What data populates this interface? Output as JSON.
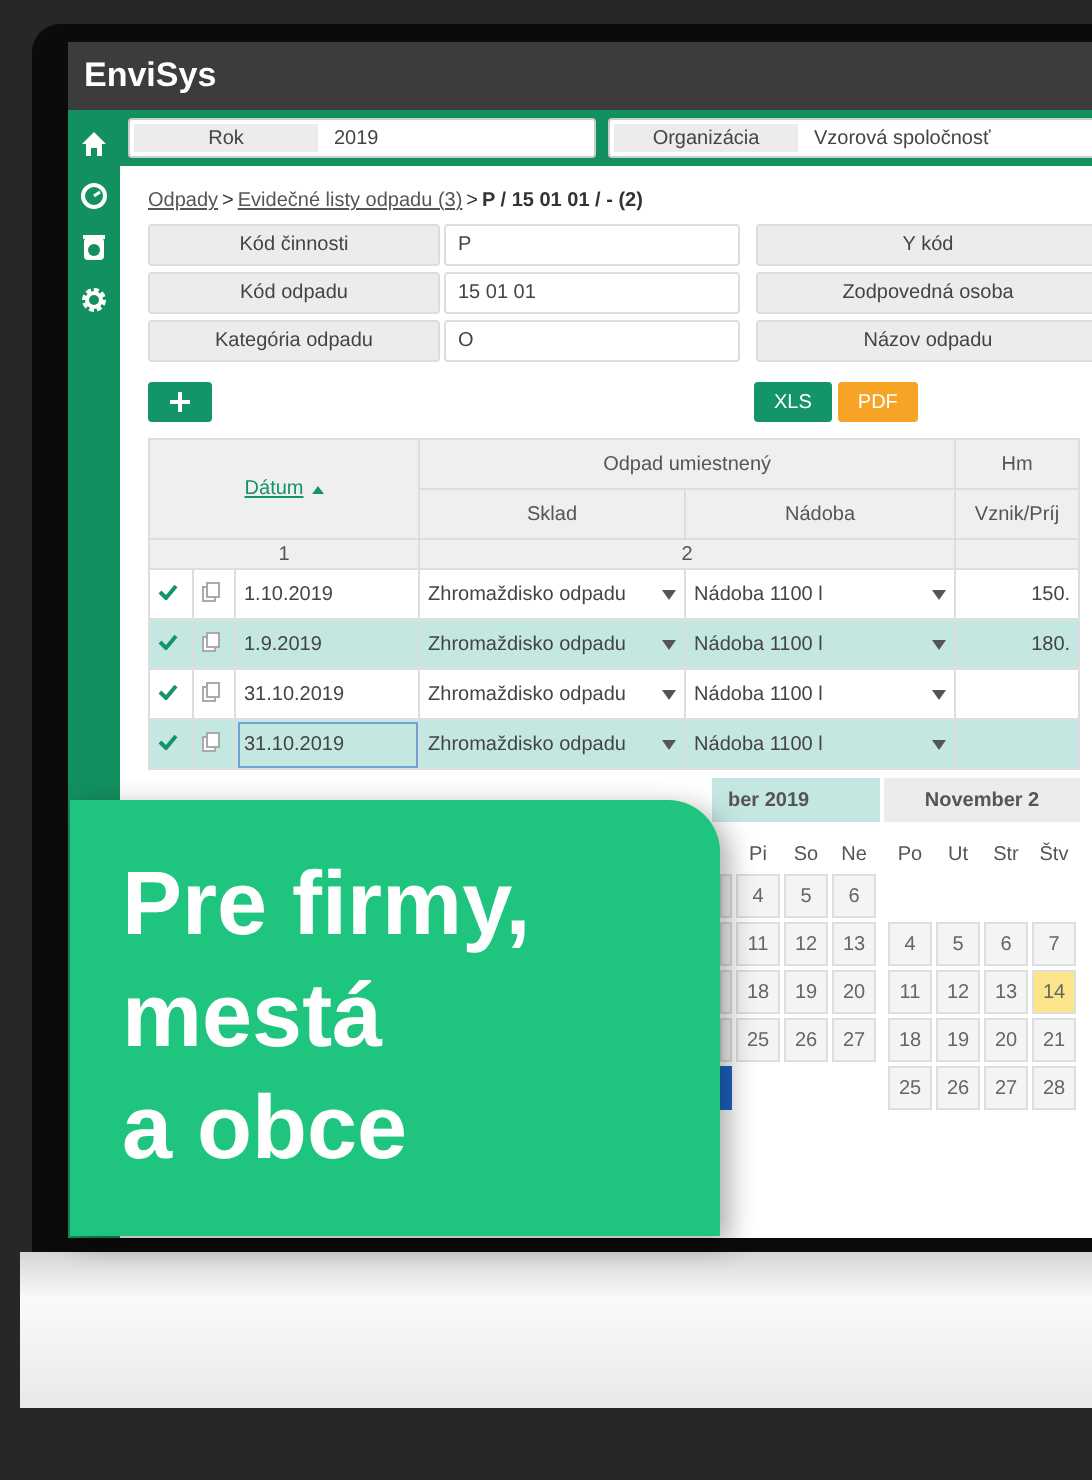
{
  "window": {
    "title": "EnviSys"
  },
  "filters": [
    {
      "label": "Rok",
      "value": "2019"
    },
    {
      "label": "Organizácia",
      "value": "Vzorová spoločnosť"
    }
  ],
  "breadcrumb": [
    {
      "kind": "link",
      "text": "Odpady"
    },
    {
      "kind": "separator",
      "text": ">"
    },
    {
      "kind": "link",
      "text": "Evidečné listy odpadu (3)"
    },
    {
      "kind": "separator",
      "text": ">"
    },
    {
      "kind": "current",
      "text": "P / 15 01 01 / - (2)"
    }
  ],
  "form": {
    "left": [
      {
        "label": "Kód činnosti",
        "value": "P"
      },
      {
        "label": "Kód odpadu",
        "value": "15 01 01"
      },
      {
        "label": "Kategória odpadu",
        "value": "O"
      }
    ],
    "right": [
      {
        "label": "Y kód"
      },
      {
        "label": "Zodpovedná osoba"
      },
      {
        "label": "Názov odpadu"
      }
    ]
  },
  "exports": [
    {
      "label": "XLS",
      "color": "#14946a"
    },
    {
      "label": "PDF",
      "color": "#f7a326"
    }
  ],
  "table": {
    "date_header": "Dátum",
    "group_header": "Odpad umiestnený",
    "cut_header": "Hm",
    "columns": [
      "Sklad",
      "Nádoba",
      "Vznik/Príj"
    ],
    "numbers": [
      "1",
      "2"
    ],
    "rows": [
      {
        "checked": true,
        "editing": false,
        "date": "1.10.2019",
        "sklad": "Zhromaždisko odpadu",
        "nadoba": "Nádoba 1100 l",
        "amount": "150."
      },
      {
        "checked": true,
        "editing": false,
        "date": "1.9.2019",
        "sklad": "Zhromaždisko odpadu",
        "nadoba": "Nádoba 1100 l",
        "amount": "180."
      },
      {
        "checked": true,
        "editing": false,
        "date": "31.10.2019",
        "sklad": "Zhromaždisko odpadu",
        "nadoba": "Nádoba 1100 l"
      },
      {
        "checked": true,
        "editing": true,
        "date": "31.10.2019",
        "sklad": "Zhromaždisko odpadu",
        "nadoba": "Nádoba 1100 l"
      }
    ]
  },
  "calendar": [
    {
      "title": "ber 2019",
      "weekdays": [
        "Pi",
        "So",
        "Ne"
      ],
      "weeks": [
        {
          "kind": "days",
          "days": [
            {
              "kind": "partial",
              "selected": false
            },
            {
              "kind": "day",
              "day": "4",
              "selected": false,
              "today": false
            },
            {
              "kind": "day",
              "day": "5",
              "selected": false,
              "today": false
            },
            {
              "kind": "day",
              "day": "6",
              "selected": false,
              "today": false
            }
          ]
        },
        {
          "kind": "days",
          "days": [
            {
              "kind": "partial",
              "selected": false
            },
            {
              "kind": "day",
              "day": "11",
              "selected": false,
              "today": false
            },
            {
              "kind": "day",
              "day": "12",
              "selected": false,
              "today": false
            },
            {
              "kind": "day",
              "day": "13",
              "selected": false,
              "today": false
            }
          ]
        },
        {
          "kind": "days",
          "days": [
            {
              "kind": "partial",
              "selected": false
            },
            {
              "kind": "day",
              "day": "18",
              "selected": false,
              "today": false
            },
            {
              "kind": "day",
              "day": "19",
              "selected": false,
              "today": false
            },
            {
              "kind": "day",
              "day": "20",
              "selected": false,
              "today": false
            }
          ]
        },
        {
          "kind": "days",
          "days": [
            {
              "kind": "partial",
              "selected": false
            },
            {
              "kind": "day",
              "day": "25",
              "selected": false,
              "today": false
            },
            {
              "kind": "day",
              "day": "26",
              "selected": false,
              "today": false
            },
            {
              "kind": "day",
              "day": "27",
              "selected": false,
              "today": false
            }
          ]
        },
        {
          "kind": "days",
          "days": [
            {
              "kind": "partial",
              "selected": true
            }
          ]
        }
      ]
    },
    {
      "title": "November 2",
      "weekdays": [
        "Po",
        "Ut",
        "Str",
        "Štv"
      ],
      "weeks": [
        {
          "kind": "blank"
        },
        {
          "kind": "days",
          "days": [
            {
              "kind": "day",
              "day": "4",
              "selected": false,
              "today": false
            },
            {
              "kind": "day",
              "day": "5",
              "selected": false,
              "today": false
            },
            {
              "kind": "day",
              "day": "6",
              "selected": false,
              "today": false
            },
            {
              "kind": "day",
              "day": "7",
              "selected": false,
              "today": false
            }
          ]
        },
        {
          "kind": "days",
          "days": [
            {
              "kind": "day",
              "day": "11",
              "selected": false,
              "today": false
            },
            {
              "kind": "day",
              "day": "12",
              "selected": false,
              "today": false
            },
            {
              "kind": "day",
              "day": "13",
              "selected": false,
              "today": false
            },
            {
              "kind": "day",
              "day": "14",
              "selected": false,
              "today": true
            }
          ]
        },
        {
          "kind": "days",
          "days": [
            {
              "kind": "day",
              "day": "18",
              "selected": false,
              "today": false
            },
            {
              "kind": "day",
              "day": "19",
              "selected": false,
              "today": false
            },
            {
              "kind": "day",
              "day": "20",
              "selected": false,
              "today": false
            },
            {
              "kind": "day",
              "day": "21",
              "selected": false,
              "today": false
            }
          ]
        },
        {
          "kind": "days",
          "days": [
            {
              "kind": "day",
              "day": "25",
              "selected": false,
              "today": false
            },
            {
              "kind": "day",
              "day": "26",
              "selected": false,
              "today": false
            },
            {
              "kind": "day",
              "day": "27",
              "selected": false,
              "today": false
            },
            {
              "kind": "day",
              "day": "28",
              "selected": false,
              "today": false
            }
          ]
        }
      ]
    }
  ],
  "promo": {
    "lines": [
      "Pre firmy,",
      "mestá",
      "a obce"
    ]
  }
}
